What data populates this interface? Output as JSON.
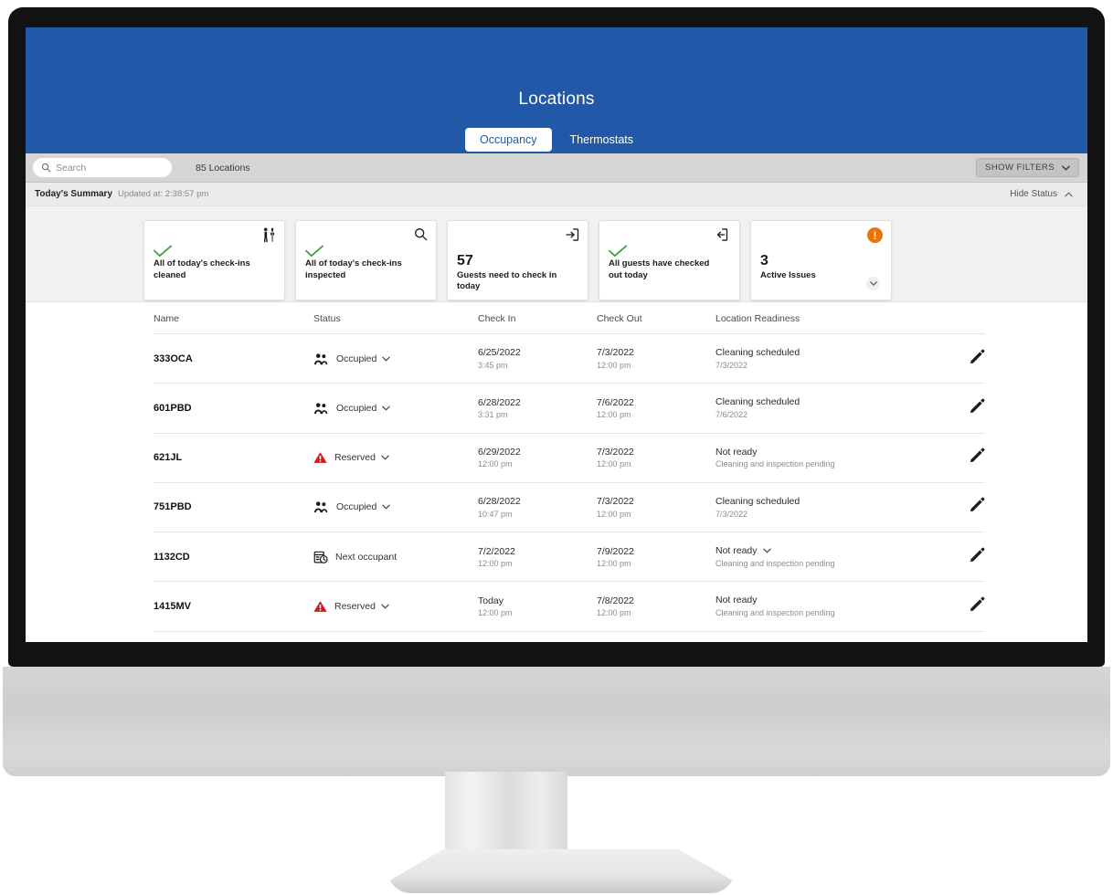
{
  "header": {
    "title": "Locations",
    "brand_color": "#2158a8",
    "tabs": [
      {
        "label": "Occupancy",
        "active": true
      },
      {
        "label": "Thermostats",
        "active": false
      }
    ]
  },
  "toolbar": {
    "search_placeholder": "Search",
    "search_value": "",
    "search_icon": "search-icon",
    "location_count": "85 Locations",
    "show_filters_label": "SHOW FILTERS",
    "show_filters_icon": "chevron-down-icon"
  },
  "summary": {
    "title": "Today's Summary",
    "updated": "Updated at: 2:38:57 pm",
    "hide_status_label": "Hide Status",
    "hide_status_icon": "chevron-up-icon",
    "cards": [
      {
        "icon": "cleaning-person-icon",
        "state_icon": "check-icon",
        "state_color": "#3aa337",
        "number": "",
        "label": "All of today's check-ins cleaned"
      },
      {
        "icon": "search-icon",
        "state_icon": "check-icon",
        "state_color": "#3aa337",
        "number": "",
        "label": "All of today's check-ins inspected"
      },
      {
        "icon": "check-in-arrow-icon",
        "state_icon": "",
        "state_color": "",
        "number": "57",
        "label": "Guests need to check in today"
      },
      {
        "icon": "check-out-arrow-icon",
        "state_icon": "check-icon",
        "state_color": "#3aa337",
        "number": "",
        "label": "All guests have checked out today"
      },
      {
        "icon": "alert-badge-icon",
        "state_icon": "",
        "state_color": "#ee7203",
        "number": "3",
        "label": "Active Issues",
        "expand_icon": "chevron-down-icon"
      }
    ]
  },
  "table": {
    "columns": [
      "Name",
      "Status",
      "Check In",
      "Check Out",
      "Location Readiness"
    ],
    "rows": [
      {
        "name": "333OCA",
        "status": {
          "icon": "two-people-icon",
          "label": "Occupied",
          "chevron": true,
          "color": "#1b1b1b"
        },
        "check_in": {
          "date": "6/25/2022",
          "time": "3:45 pm"
        },
        "check_out": {
          "date": "7/3/2022",
          "time": "12:00 pm"
        },
        "readiness": {
          "primary": "Cleaning scheduled",
          "secondary": "7/3/2022",
          "chevron": false
        },
        "edit_icon": "pencil-icon"
      },
      {
        "name": "601PBD",
        "status": {
          "icon": "two-people-icon",
          "label": "Occupied",
          "chevron": true,
          "color": "#1b1b1b"
        },
        "check_in": {
          "date": "6/28/2022",
          "time": "3:31 pm"
        },
        "check_out": {
          "date": "7/6/2022",
          "time": "12:00 pm"
        },
        "readiness": {
          "primary": "Cleaning scheduled",
          "secondary": "7/6/2022",
          "chevron": false
        },
        "edit_icon": "pencil-icon"
      },
      {
        "name": "621JL",
        "status": {
          "icon": "warning-triangle-icon",
          "label": "Reserved",
          "chevron": true,
          "color": "#d0181d"
        },
        "check_in": {
          "date": "6/29/2022",
          "time": "12:00 pm"
        },
        "check_out": {
          "date": "7/3/2022",
          "time": "12:00 pm"
        },
        "readiness": {
          "primary": "Not ready",
          "secondary": "Cleaning and inspection pending",
          "chevron": false
        },
        "edit_icon": "pencil-icon"
      },
      {
        "name": "751PBD",
        "status": {
          "icon": "two-people-icon",
          "label": "Occupied",
          "chevron": true,
          "color": "#1b1b1b"
        },
        "check_in": {
          "date": "6/28/2022",
          "time": "10:47 pm"
        },
        "check_out": {
          "date": "7/3/2022",
          "time": "12:00 pm"
        },
        "readiness": {
          "primary": "Cleaning scheduled",
          "secondary": "7/3/2022",
          "chevron": false
        },
        "edit_icon": "pencil-icon"
      },
      {
        "name": "1132CD",
        "status": {
          "icon": "calendar-clock-icon",
          "label": "Next occupant",
          "chevron": false,
          "color": "#1b1b1b"
        },
        "check_in": {
          "date": "7/2/2022",
          "time": "12:00 pm"
        },
        "check_out": {
          "date": "7/9/2022",
          "time": "12:00 pm"
        },
        "readiness": {
          "primary": "Not ready",
          "secondary": "Cleaning and inspection pending",
          "chevron": true
        },
        "edit_icon": "pencil-icon"
      },
      {
        "name": "1415MV",
        "status": {
          "icon": "warning-triangle-icon",
          "label": "Reserved",
          "chevron": true,
          "color": "#d0181d"
        },
        "check_in": {
          "date": "Today",
          "time": "12:00 pm"
        },
        "check_out": {
          "date": "7/8/2022",
          "time": "12:00 pm"
        },
        "readiness": {
          "primary": "Not ready",
          "secondary": "Cleaning and inspection pending",
          "chevron": false
        },
        "edit_icon": "pencil-icon"
      }
    ]
  }
}
